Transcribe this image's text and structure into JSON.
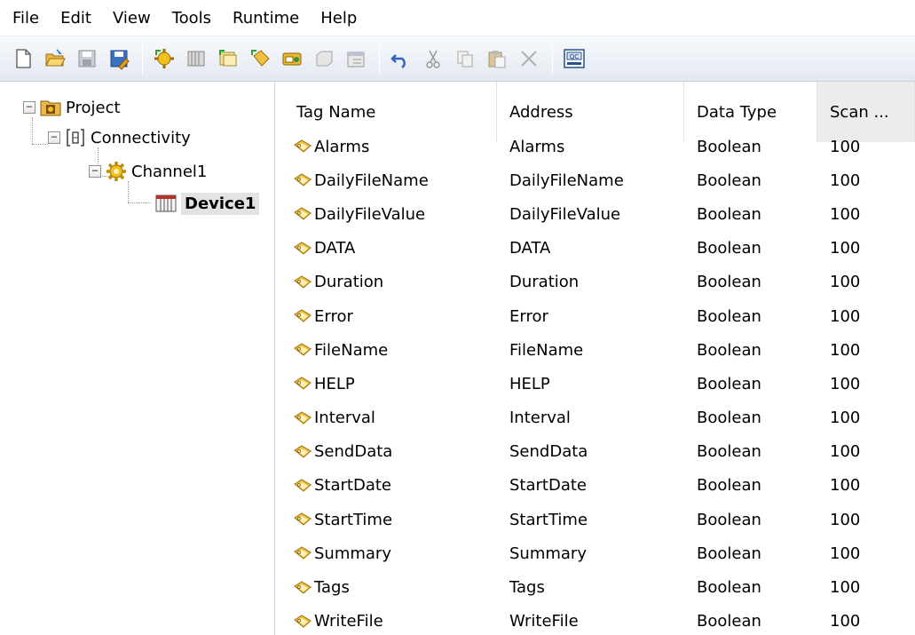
{
  "menu": [
    "File",
    "Edit",
    "View",
    "Tools",
    "Runtime",
    "Help"
  ],
  "toolbar": {
    "buttons": [
      "new-icon",
      "open-icon",
      "save-icon",
      "save-as-icon",
      "new-channel-icon",
      "new-device-icon",
      "new-tag-group-icon",
      "new-tag-icon",
      "bulk-tag-icon",
      "duplicate-icon",
      "properties-icon",
      "undo-icon",
      "cut-icon",
      "copy-icon",
      "paste-icon",
      "delete-icon",
      "quick-client-icon"
    ],
    "quick_client_label": "QC"
  },
  "tree": {
    "project": "Project",
    "connectivity": "Connectivity",
    "channel": "Channel1",
    "device": "Device1"
  },
  "table": {
    "columns": [
      "Tag Name",
      "Address",
      "Data Type",
      "Scan ..."
    ],
    "rows": [
      {
        "name": "Alarms",
        "address": "Alarms",
        "type": "Boolean",
        "scan": "100"
      },
      {
        "name": "DailyFileName",
        "address": "DailyFileName",
        "type": "Boolean",
        "scan": "100"
      },
      {
        "name": "DailyFileValue",
        "address": "DailyFileValue",
        "type": "Boolean",
        "scan": "100"
      },
      {
        "name": "DATA",
        "address": "DATA",
        "type": "Boolean",
        "scan": "100"
      },
      {
        "name": "Duration",
        "address": "Duration",
        "type": "Boolean",
        "scan": "100"
      },
      {
        "name": "Error",
        "address": "Error",
        "type": "Boolean",
        "scan": "100"
      },
      {
        "name": "FileName",
        "address": "FileName",
        "type": "Boolean",
        "scan": "100"
      },
      {
        "name": "HELP",
        "address": "HELP",
        "type": "Boolean",
        "scan": "100"
      },
      {
        "name": "Interval",
        "address": "Interval",
        "type": "Boolean",
        "scan": "100"
      },
      {
        "name": "SendData",
        "address": "SendData",
        "type": "Boolean",
        "scan": "100"
      },
      {
        "name": "StartDate",
        "address": "StartDate",
        "type": "Boolean",
        "scan": "100"
      },
      {
        "name": "StartTime",
        "address": "StartTime",
        "type": "Boolean",
        "scan": "100"
      },
      {
        "name": "Summary",
        "address": "Summary",
        "type": "Boolean",
        "scan": "100"
      },
      {
        "name": "Tags",
        "address": "Tags",
        "type": "Boolean",
        "scan": "100"
      },
      {
        "name": "WriteFile",
        "address": "WriteFile",
        "type": "Boolean",
        "scan": "100"
      }
    ]
  },
  "colors": {
    "tag_icon": "#f0c040",
    "toolbar_gradient_top": "#f7f9fc",
    "toolbar_gradient_bottom": "#e4e9f1",
    "selection": "#e3e3e3"
  }
}
